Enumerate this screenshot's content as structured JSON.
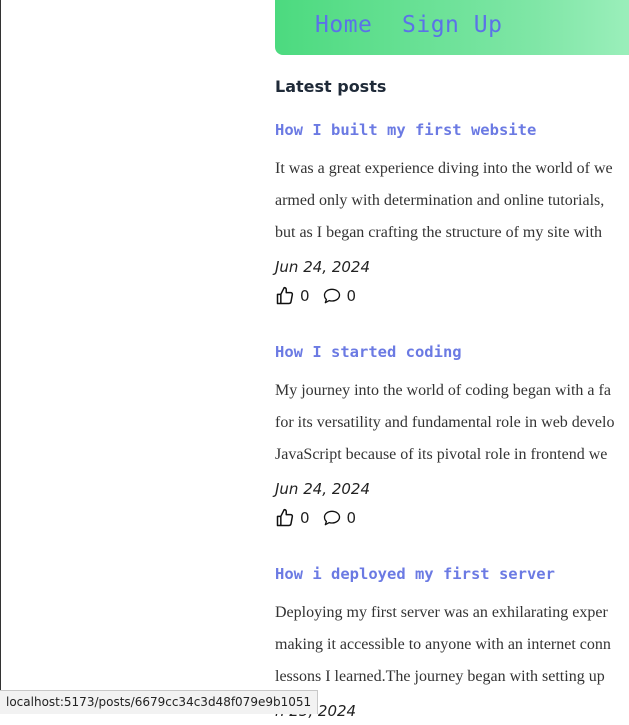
{
  "nav": {
    "home": "Home",
    "signup": "Sign Up"
  },
  "section_title": "Latest posts",
  "posts": [
    {
      "title": "How I built my first website",
      "lines": [
        "It was a great experience diving into the world of we",
        "armed only with determination and online tutorials,",
        "but as I began crafting the structure of my site with"
      ],
      "date": "Jun 24, 2024",
      "likes": "0",
      "comments": "0"
    },
    {
      "title": "How I started coding",
      "lines": [
        "My journey into the world of coding began with a fa",
        "for its versatility and fundamental role in web develo",
        "JavaScript because of its pivotal role in frontend we"
      ],
      "date": "Jun 24, 2024",
      "likes": "0",
      "comments": "0"
    },
    {
      "title": "How i deployed my first server",
      "lines": [
        "Deploying my first server was an exhilarating exper",
        "making it accessible to anyone with an internet conn",
        "lessons I learned.The journey began with setting up"
      ],
      "date": "n 25, 2024",
      "likes": "",
      "comments": ""
    }
  ],
  "status_url": "localhost:5173/posts/6679cc34c3d48f079e9b1051"
}
